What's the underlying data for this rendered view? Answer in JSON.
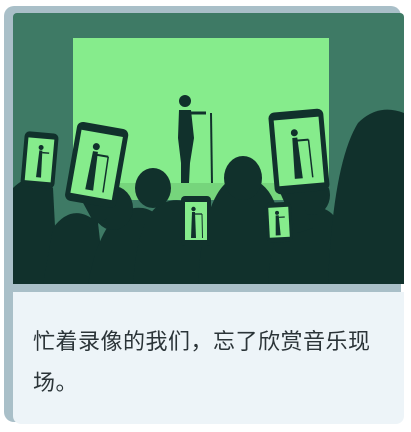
{
  "card": {
    "caption": "忙着录像的我们，忘了欣赏音乐现场。"
  },
  "colors": {
    "frame": "#a9bfc8",
    "background": "#3e7a65",
    "stage_screen": "#86ec8c",
    "silhouette": "#11312c",
    "caption_bg": "#edf4f8",
    "caption_text": "#2b3438"
  },
  "icons": {
    "illustration": "concert-crowd-filming-with-phones"
  }
}
